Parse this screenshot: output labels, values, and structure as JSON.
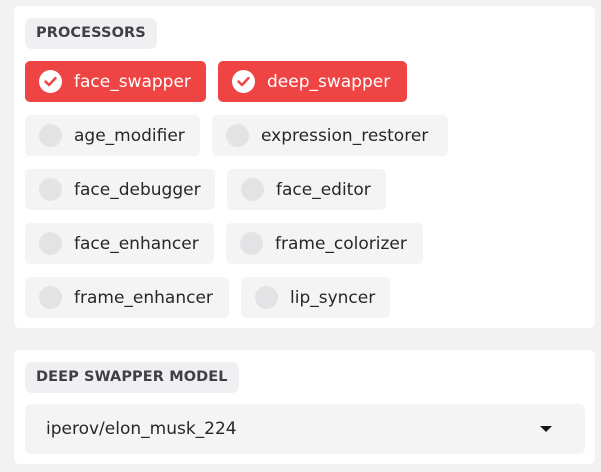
{
  "processors": {
    "label": "PROCESSORS",
    "options": [
      {
        "name": "face_swapper",
        "checked": true
      },
      {
        "name": "deep_swapper",
        "checked": true
      },
      {
        "name": "age_modifier",
        "checked": false
      },
      {
        "name": "expression_restorer",
        "checked": false
      },
      {
        "name": "face_debugger",
        "checked": false
      },
      {
        "name": "face_editor",
        "checked": false
      },
      {
        "name": "face_enhancer",
        "checked": false
      },
      {
        "name": "frame_colorizer",
        "checked": false
      },
      {
        "name": "frame_enhancer",
        "checked": false
      },
      {
        "name": "lip_syncer",
        "checked": false
      }
    ]
  },
  "deep_swapper_model": {
    "label": "DEEP SWAPPER MODEL",
    "selected": "iperov/elon_musk_224"
  },
  "colors": {
    "accent": "#ef4444",
    "chip_bg": "#f4f4f5",
    "page_bg": "#f2f2f3"
  },
  "icons": {
    "checked": "checkmark-icon",
    "dropdown": "caret-down-icon"
  }
}
